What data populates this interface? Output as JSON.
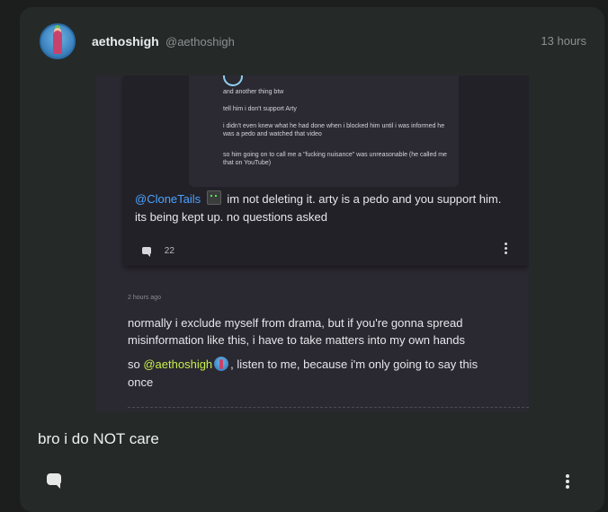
{
  "post": {
    "username": "aethoshigh",
    "handle": "@aethoshigh",
    "time": "13 hours",
    "caption": "bro i do NOT care",
    "icons": {
      "comment": "comment-icon",
      "more": "more-vertical-icon"
    }
  },
  "screenshot": {
    "quoted_lines": [
      "and another thing btw",
      "tell him i don't support Arty",
      "i didn't even knew what he had done when i blocked him until i was informed he was a pedo and watched that video",
      "so him going on to call me a \"fucking nuisance\" was unreasonable (he called me that on YouTube)"
    ],
    "reply": {
      "mention": "@CloneTails",
      "text": "im not deleting it. arty is a pedo and you support him. its being kept up. no questions asked",
      "comment_count": "22"
    },
    "second": {
      "ago": "2 hours ago",
      "para1": "normally i exclude myself from drama, but if you're gonna spread misinformation like this, i have to take matters into my own hands",
      "para2_prefix": "so",
      "mention": "@aethoshigh",
      "para2_suffix": ", listen to me, because i'm only going to say this once"
    }
  },
  "colors": {
    "background": "#1c1e1e",
    "card": "#252a29",
    "mention_blue": "#4aa3ff",
    "mention_green": "#c8f04a"
  }
}
